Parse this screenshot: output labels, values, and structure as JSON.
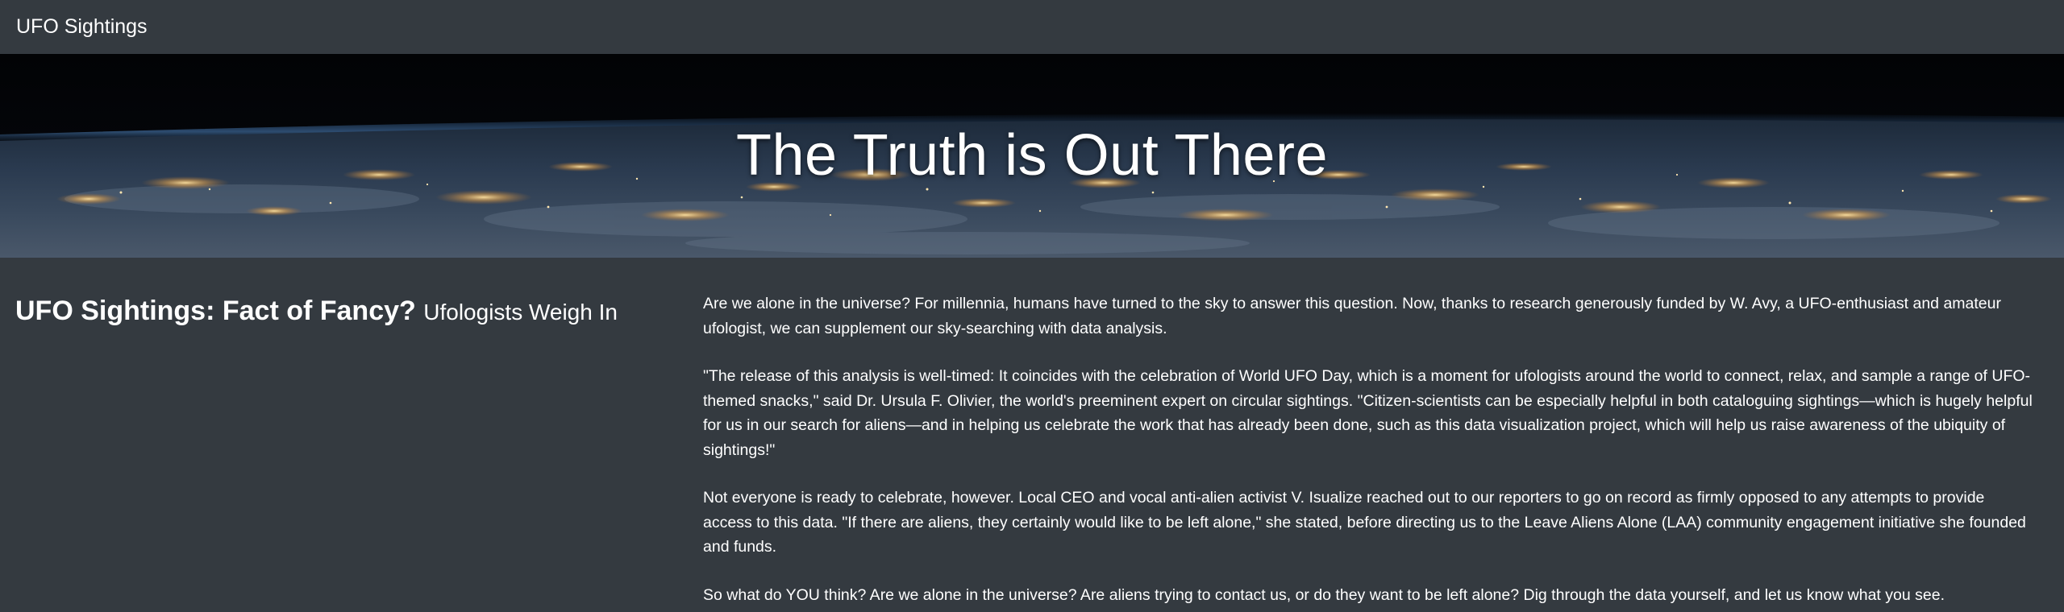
{
  "navbar": {
    "brand": "UFO Sightings"
  },
  "hero": {
    "title": "The Truth is Out There",
    "background_image": "earth-at-night-from-space"
  },
  "article": {
    "heading": "UFO Sightings: Fact of Fancy?",
    "subheading": "Ufologists Weigh In",
    "paragraphs": [
      "Are we alone in the universe? For millennia, humans have turned to the sky to answer this question. Now, thanks to research generously funded by W. Avy, a UFO-enthusiast and amateur ufologist, we can supplement our sky-searching with data analysis.",
      "\"The release of this analysis is well-timed: It coincides with the celebration of World UFO Day, which is a moment for ufologists around the world to connect, relax, and sample a range of UFO-themed snacks,\" said Dr. Ursula F. Olivier, the world's preeminent expert on circular sightings. \"Citizen-scientists can be especially helpful in both cataloguing sightings—which is hugely helpful for us in our search for aliens—and in helping us celebrate the work that has already been done, such as this data visualization project, which will help us raise awareness of the ubiquity of sightings!\"",
      "Not everyone is ready to celebrate, however. Local CEO and vocal anti-alien activist V. Isualize reached out to our reporters to go on record as firmly opposed to any attempts to provide access to this data. \"If there are aliens, they certainly would like to be left alone,\" she stated, before directing us to the Leave Aliens Alone (LAA) community engagement initiative she founded and funds.",
      "So what do YOU think? Are we alone in the universe? Are aliens trying to contact us, or do they want to be left alone? Dig through the data yourself, and let us know what you see."
    ]
  },
  "colors": {
    "page_background": "#343a40",
    "text": "#ffffff"
  }
}
